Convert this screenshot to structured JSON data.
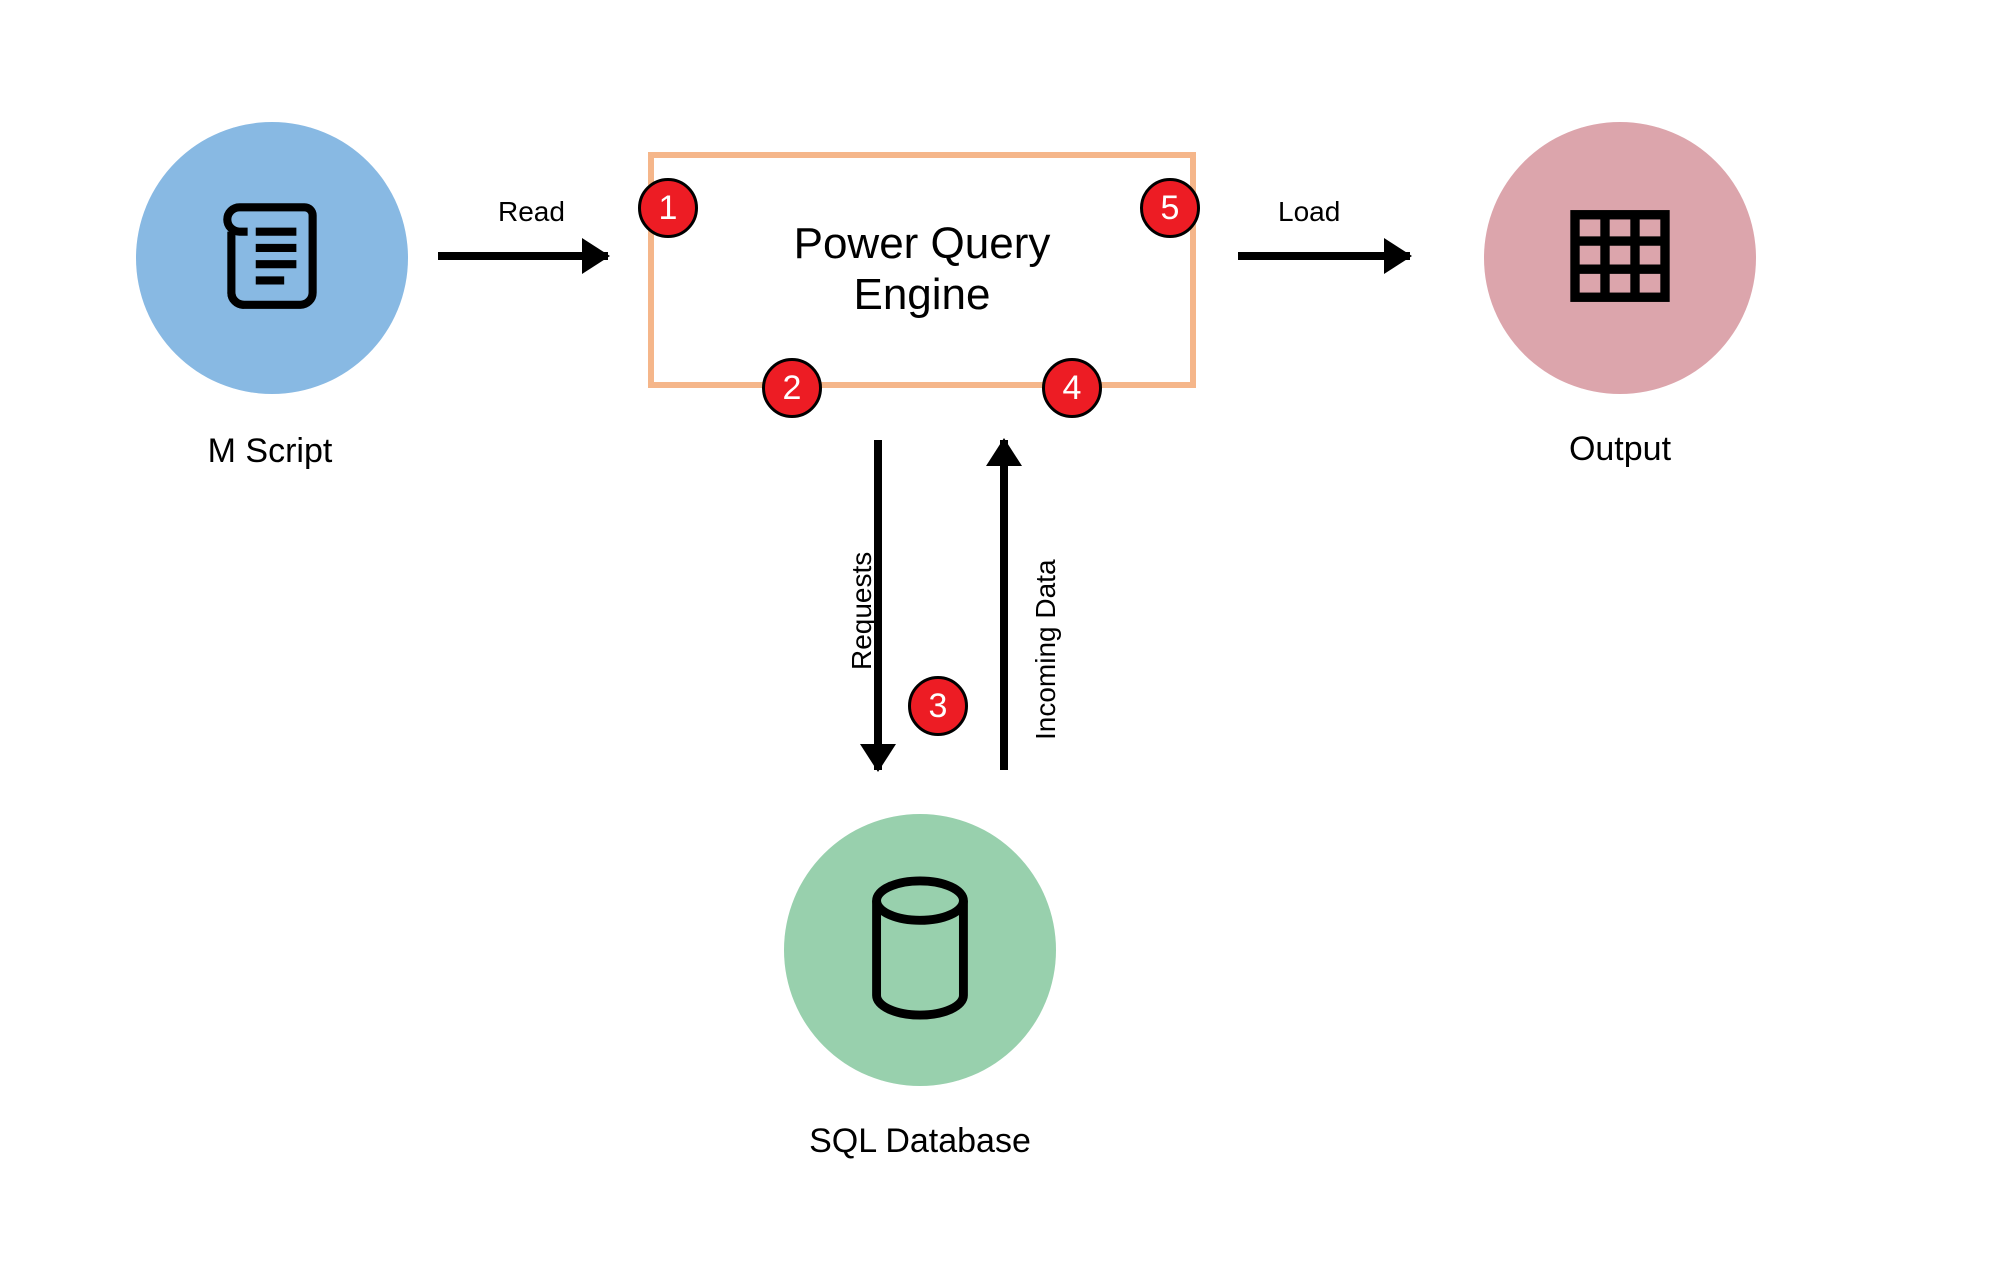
{
  "nodes": {
    "m_script": {
      "label": "M Script",
      "color": "#88b9e3"
    },
    "engine": {
      "label_line1": "Power Query",
      "label_line2": "Engine",
      "border": "#f5b68a"
    },
    "output": {
      "label": "Output",
      "color": "#dca5ac"
    },
    "database": {
      "label": "SQL Database",
      "color": "#98d0ad"
    }
  },
  "edges": {
    "read": {
      "label": "Read"
    },
    "load": {
      "label": "Load"
    },
    "requests": {
      "label": "Requests"
    },
    "incoming": {
      "label": "Incoming Data"
    }
  },
  "steps": {
    "s1": "1",
    "s2": "2",
    "s3": "3",
    "s4": "4",
    "s5": "5"
  }
}
